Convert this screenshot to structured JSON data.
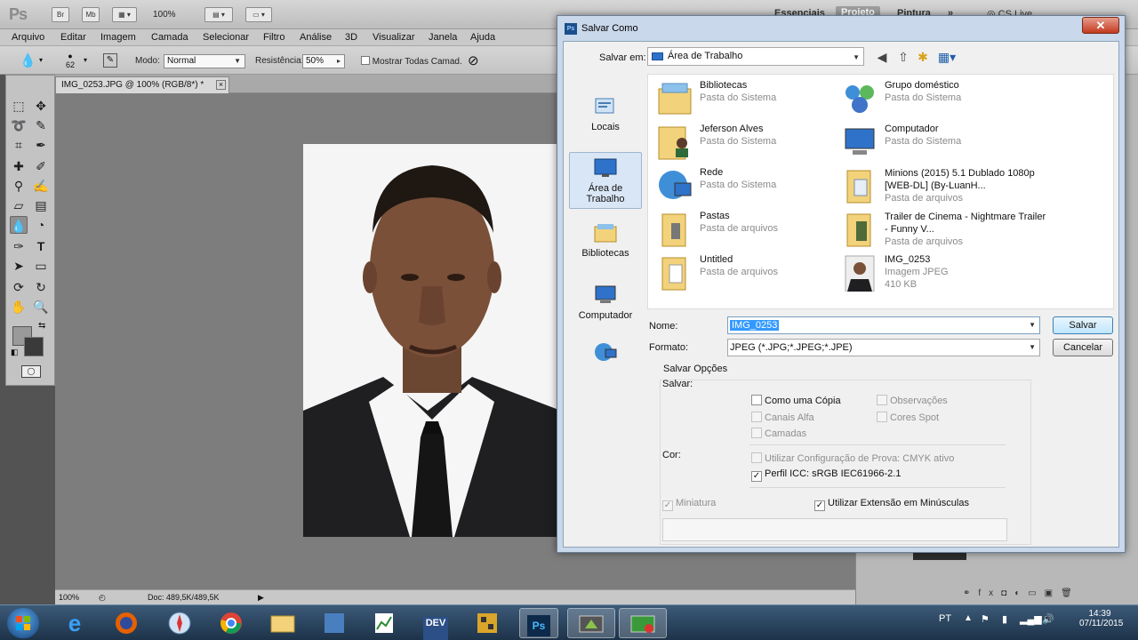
{
  "photoshop": {
    "logo": "Ps",
    "app_buttons": [
      "Br",
      "Mb"
    ],
    "zoom": "100%",
    "workspaces": [
      "Essenciais",
      "Projeto",
      "Pintura"
    ],
    "workspace_more": "»",
    "cslive": "CS Live",
    "menu": [
      "Arquivo",
      "Editar",
      "Imagem",
      "Camada",
      "Selecionar",
      "Filtro",
      "Análise",
      "3D",
      "Visualizar",
      "Janela",
      "Ajuda"
    ],
    "options": {
      "brush_size": "62",
      "mode_label": "Modo:",
      "mode_value": "Normal",
      "strength_label": "Resistência:",
      "strength_value": "50%",
      "sample_all_label": "Mostrar Todas Camad."
    },
    "document_tab": "IMG_0253.JPG @ 100% (RGB/8*) *",
    "document_tab_close": "×",
    "status": {
      "zoom": "100%",
      "doc": "Doc: 489,5K/489,5K"
    }
  },
  "dialog": {
    "title": "Salvar Como",
    "close": "✕",
    "save_in_label": "Salvar em:",
    "save_in_value": "Área de Trabalho",
    "places": [
      {
        "label": "Locais",
        "icon": "recent-places-icon"
      },
      {
        "label": "Área de Trabalho",
        "icon": "desktop-icon"
      },
      {
        "label": "Bibliotecas",
        "icon": "libraries-icon"
      },
      {
        "label": "Computador",
        "icon": "computer-icon"
      },
      {
        "label": "",
        "icon": "network-icon"
      }
    ],
    "files": [
      {
        "name": "Bibliotecas",
        "sub1": "Pasta do Sistema",
        "sub2": "",
        "icon": "libraries-icon"
      },
      {
        "name": "Grupo doméstico",
        "sub1": "Pasta do Sistema",
        "sub2": "",
        "icon": "homegroup-icon"
      },
      {
        "name": "Jeferson Alves",
        "sub1": "Pasta do Sistema",
        "sub2": "",
        "icon": "user-folder-icon"
      },
      {
        "name": "Computador",
        "sub1": "Pasta do Sistema",
        "sub2": "",
        "icon": "computer-icon"
      },
      {
        "name": "Rede",
        "sub1": "Pasta do Sistema",
        "sub2": "",
        "icon": "network-icon"
      },
      {
        "name": "Minions (2015) 5.1 Dublado 1080p [WEB-DL] (By-LuanH...",
        "sub1": "Pasta de arquivos",
        "sub2": "",
        "icon": "folder-icon"
      },
      {
        "name": "Pastas",
        "sub1": "Pasta de arquivos",
        "sub2": "",
        "icon": "folder-icon"
      },
      {
        "name": "Trailer de Cinema - Nightmare Trailer - Funny V...",
        "sub1": "Pasta de arquivos",
        "sub2": "",
        "icon": "folder-icon"
      },
      {
        "name": "Untitled",
        "sub1": "Pasta de arquivos",
        "sub2": "",
        "icon": "folder-icon"
      },
      {
        "name": "IMG_0253",
        "sub1": "Imagem JPEG",
        "sub2": "410 KB",
        "icon": "jpeg-thumbnail-icon"
      }
    ],
    "name_label": "Nome:",
    "name_value": "IMG_0253",
    "format_label": "Formato:",
    "format_value": "JPEG (*.JPG;*.JPEG;*.JPE)",
    "save_button": "Salvar",
    "cancel_button": "Cancelar",
    "options_title": "Salvar Opções",
    "save_label": "Salvar:",
    "checks": {
      "copy": "Como uma Cópia",
      "notes": "Observações",
      "alpha": "Canais Alfa",
      "spot": "Cores Spot",
      "layers": "Camadas"
    },
    "color_label": "Cor:",
    "proof": "Utilizar Configuração de Prova: CMYK ativo",
    "icc": "Perfil ICC: sRGB IEC61966-2.1",
    "thumbnail": "Miniatura",
    "lowercase": "Utilizar Extensão em Minúsculas"
  },
  "taskbar": {
    "apps": [
      "start",
      "internet-explorer",
      "firefox",
      "safari",
      "chrome",
      "explorer",
      "app",
      "app",
      "dev",
      "app",
      "photoshop",
      "app",
      "app"
    ],
    "dev_label": "DEV",
    "ps_label": "Ps",
    "lang": "PT",
    "time": "14:39",
    "date": "07/11/2015"
  }
}
